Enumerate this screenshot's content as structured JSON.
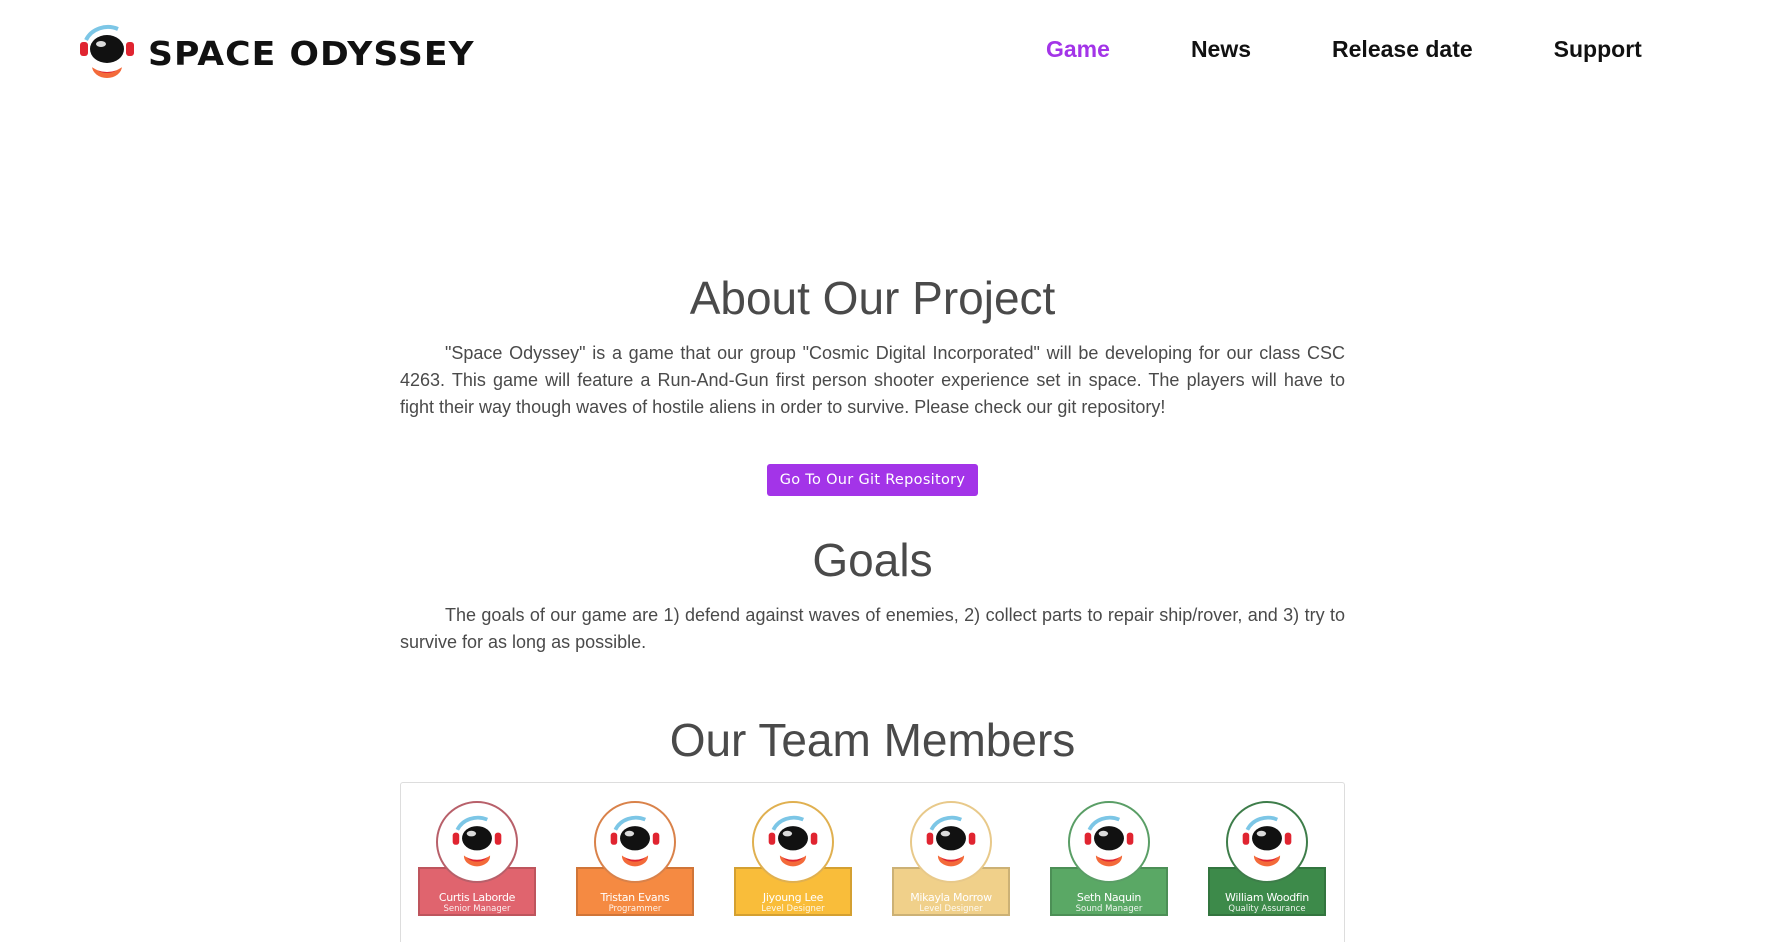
{
  "brand": {
    "name": "SPACE ODYSSEY",
    "logo_icon": "astronaut-helmet-icon"
  },
  "nav": {
    "items": [
      {
        "label": "Game",
        "active": true
      },
      {
        "label": "News",
        "active": false
      },
      {
        "label": "Release date",
        "active": false
      },
      {
        "label": "Support",
        "active": false
      }
    ]
  },
  "about": {
    "title": "About Our Project",
    "text": "\"Space Odyssey\" is a game that our group \"Cosmic Digital Incorporated\" will be developing for our class CSC 4263. This game will feature a Run-And-Gun first person shooter experience set in space. The players will have to fight their way though waves of hostile aliens in order to survive. Please check our git repository!",
    "button_label": "Go To Our Git Repository"
  },
  "goals": {
    "title": "Goals",
    "text": "The goals of our game are 1) defend against waves of enemies, 2) collect parts to repair ship/rover, and 3) try to survive for as long as possible."
  },
  "team": {
    "title": "Our Team Members",
    "members": [
      {
        "name": "Curtis Laborde",
        "role": "Senior Manager",
        "color": "#e0646e",
        "ring": "#b8606a"
      },
      {
        "name": "Tristan Evans",
        "role": "Programmer",
        "color": "#f58a42",
        "ring": "#d9824a"
      },
      {
        "name": "Jiyoung Lee",
        "role": "Level Designer",
        "color": "#f9bd3a",
        "ring": "#e0b050"
      },
      {
        "name": "Mikayla Morrow",
        "role": "Level Designer",
        "color": "#f0d08a",
        "ring": "#e8c98a"
      },
      {
        "name": "Seth Naquin",
        "role": "Sound Manager",
        "color": "#5aa865",
        "ring": "#5a9e66"
      },
      {
        "name": "William Woodfin",
        "role": "Quality Assurance",
        "color": "#3d8a4a",
        "ring": "#3e7d4a"
      }
    ]
  }
}
